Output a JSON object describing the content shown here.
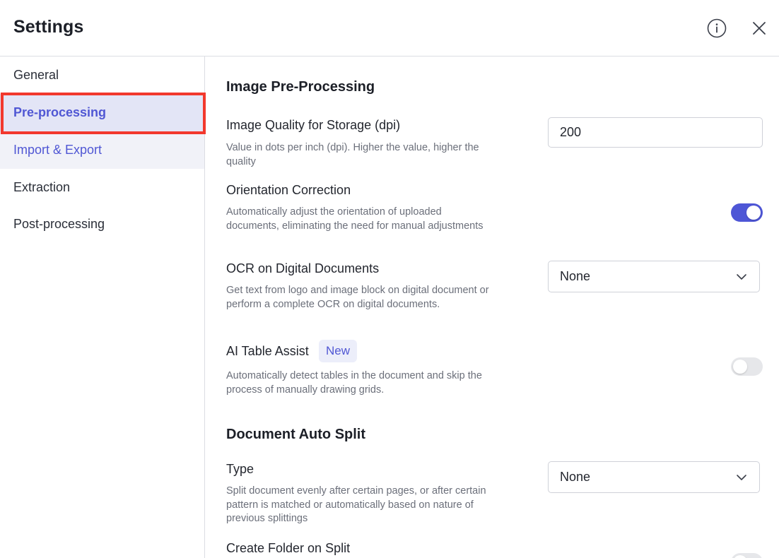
{
  "header": {
    "title": "Settings",
    "info_icon": "info-circle-icon",
    "close_icon": "close-icon"
  },
  "sidebar": {
    "items": [
      {
        "label": "General"
      },
      {
        "label": "Pre-processing"
      },
      {
        "label": "Import & Export"
      },
      {
        "label": "Extraction"
      },
      {
        "label": "Post-processing"
      }
    ],
    "active_index": 1
  },
  "main": {
    "sections": {
      "image_preprocessing": {
        "title": "Image Pre-Processing"
      },
      "document_auto_split": {
        "title": "Document Auto Split"
      }
    },
    "settings": {
      "image_quality": {
        "label": "Image Quality for Storage (dpi)",
        "description": "Value in dots per inch (dpi). Higher the value, higher the quality",
        "value": "200"
      },
      "orientation_correction": {
        "label": "Orientation Correction",
        "description": "Automatically adjust the orientation of uploaded documents, eliminating the need for manual adjustments",
        "enabled": true
      },
      "ocr_digital": {
        "label": "OCR on Digital Documents",
        "description": "Get text from logo and image block on digital document or perform a complete OCR on digital documents.",
        "value": "None"
      },
      "ai_table_assist": {
        "label": "AI Table Assist",
        "badge": "New",
        "description": "Automatically detect tables in the document and skip the process of manually drawing grids.",
        "enabled": false
      },
      "split_type": {
        "label": "Type",
        "description": "Split document evenly after certain pages, or after certain pattern is matched or automatically based on nature of previous splittings",
        "value": "None"
      },
      "create_folder_on_split": {
        "label": "Create Folder on Split",
        "enabled": false
      }
    }
  },
  "colors": {
    "accent": "#5057d4",
    "toggle_on": "#4e56d6",
    "active_nav_bg": "#e3e5f6",
    "highlight_border": "#f2382d"
  }
}
